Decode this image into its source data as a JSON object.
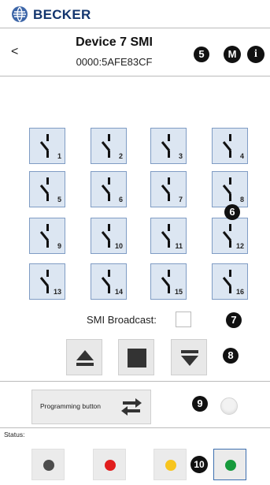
{
  "brand": {
    "name": "BECKER",
    "logo_icon": "becker-logo-icon",
    "color": "#13356e"
  },
  "device": {
    "back_label": "<",
    "title": "Device 7 SMI",
    "address": "0000:5AFE83CF"
  },
  "header_buttons": {
    "m_label": "M",
    "info_label": "i"
  },
  "callouts": [
    "5",
    "6",
    "7",
    "8",
    "9",
    "10"
  ],
  "channels": [
    "1",
    "2",
    "3",
    "4",
    "5",
    "6",
    "7",
    "8",
    "9",
    "10",
    "11",
    "12",
    "13",
    "14",
    "15",
    "16"
  ],
  "channel_icon": "switch-open-icon",
  "broadcast": {
    "label": "SMI Broadcast:",
    "checked": false
  },
  "controls": {
    "up_icon": "eject-up-icon",
    "stop_icon": "stop-square-icon",
    "down_icon": "down-to-line-icon"
  },
  "programming": {
    "label": "Programming button",
    "icon": "swap-arrows-icon",
    "led_state": "off"
  },
  "status": {
    "label": "Status:",
    "indicators": [
      {
        "name": "grey",
        "color": "#4d4d4d"
      },
      {
        "name": "red",
        "color": "#e11d1d"
      },
      {
        "name": "yellow",
        "color": "#f7c51e"
      },
      {
        "name": "green",
        "color": "#169a3c",
        "selected": true
      }
    ]
  }
}
